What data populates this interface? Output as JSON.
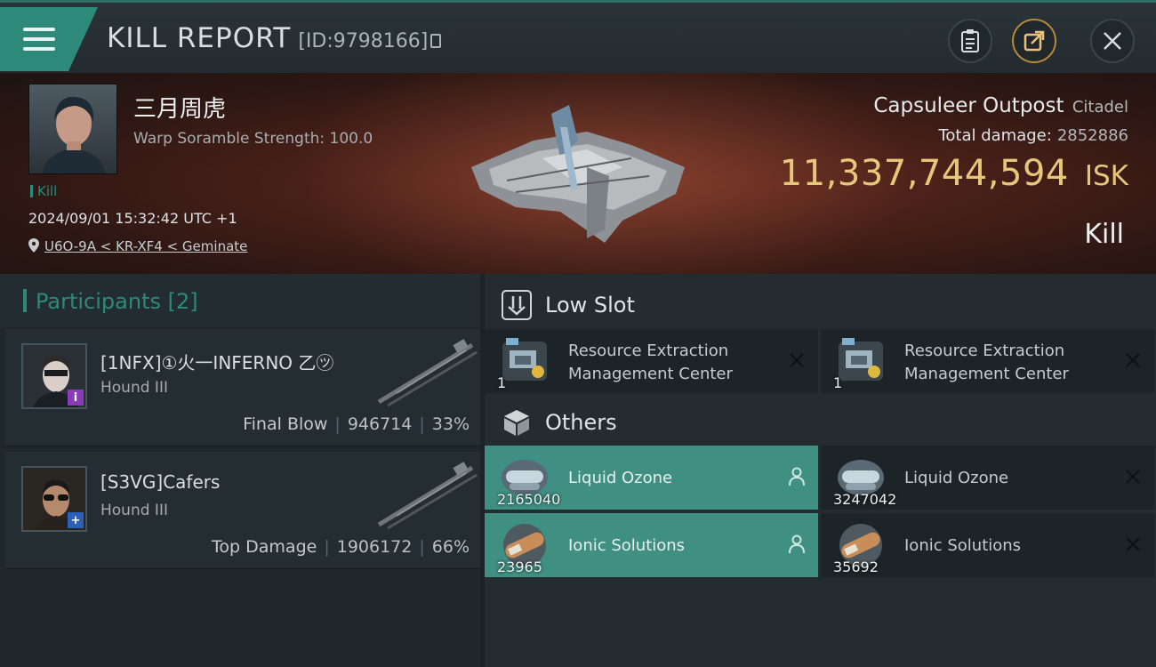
{
  "header": {
    "title": "KILL REPORT",
    "kill_id": "[ID:9798166]"
  },
  "victim": {
    "name": "三月周虎",
    "warp_scramble": "Warp Soramble Strength: 100.0",
    "kill_tag": "Kill",
    "datetime": "2024/09/01 15:32:42 UTC +1",
    "location": "U6O-9A < KR-XF4 < Geminate"
  },
  "target": {
    "name": "Capsuleer Outpost",
    "type": "Citadel",
    "total_damage_label": "Total damage:",
    "total_damage": "2852886",
    "isk_value": "11,337,744,594",
    "isk_unit": "ISK",
    "result": "Kill"
  },
  "participants": {
    "title": "Participants [2]",
    "items": [
      {
        "name": "[1NFX]①火一INFERNO 乙㋡",
        "ship": "Hound III",
        "role": "Final Blow",
        "damage": "946714",
        "percent": "33%",
        "badge": "i"
      },
      {
        "name": "[S3VG]Cafers",
        "ship": "Hound III",
        "role": "Top Damage",
        "damage": "1906172",
        "percent": "66%",
        "badge": "+"
      }
    ]
  },
  "low_slot": {
    "title": "Low Slot",
    "items": [
      {
        "name": "Resource Extraction Management Center",
        "qty": "1"
      },
      {
        "name": "Resource Extraction Management Center",
        "qty": "1"
      }
    ]
  },
  "others": {
    "title": "Others",
    "items": [
      {
        "name": "Liquid Ozone",
        "qty": "2165040",
        "dropped": true
      },
      {
        "name": "Liquid Ozone",
        "qty": "3247042",
        "dropped": false
      },
      {
        "name": "Ionic Solutions",
        "qty": "23965",
        "dropped": true
      },
      {
        "name": "Ionic Solutions",
        "qty": "35692",
        "dropped": false
      }
    ]
  },
  "colors": {
    "accent": "#2d8a7b",
    "isk": "#e7c77a",
    "highlight_row": "#3f8f82"
  },
  "icons": [
    "menu-icon",
    "clipboard-icon",
    "share-icon",
    "close-icon",
    "location-pin-icon",
    "low-slot-icon",
    "cargo-box-icon",
    "remove-icon",
    "pilot-icon"
  ]
}
